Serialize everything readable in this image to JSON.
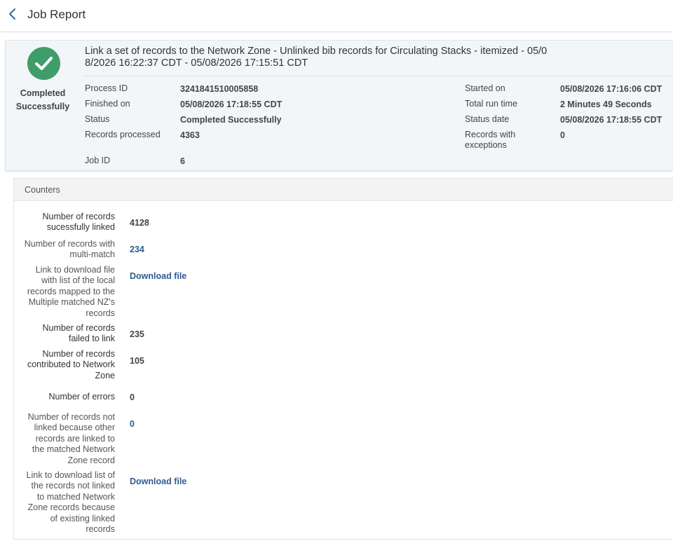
{
  "header": {
    "title": "Job Report",
    "back_icon": "chevron-left-icon",
    "accent": "#3a70a8"
  },
  "summary": {
    "status_icon": "check-circle-icon",
    "status_color": "#3f9d6c",
    "status_text_1": "Completed",
    "status_text_2": "Successfully",
    "title_line_1": "Link a set of records to the Network Zone - Unlinked bib records for Circulating Stacks - itemized - 05/0",
    "title_line_2": "8/2026 16:22:37 CDT - 05/08/2026 17:15:51 CDT",
    "left_fields": [
      {
        "label": "Process ID",
        "value": "3241841510005858"
      },
      {
        "label": "Finished on",
        "value": "05/08/2026 17:18:55 CDT"
      },
      {
        "label": "Status",
        "value": "Completed Successfully"
      },
      {
        "label": "Records processed",
        "value": "4363"
      },
      {
        "label": "Job ID",
        "value": "6"
      }
    ],
    "right_fields": [
      {
        "label": "Started on",
        "value": "05/08/2026 17:16:06 CDT"
      },
      {
        "label": "Total run time",
        "value": "2 Minutes 49 Seconds"
      },
      {
        "label": "Status date",
        "value": "05/08/2026 17:18:55 CDT"
      },
      {
        "label_1": "Records with",
        "label_2": "exceptions",
        "value": "0"
      }
    ]
  },
  "counters": {
    "heading": "Counters",
    "rows": [
      {
        "lines": [
          "Number of records",
          "sucessfully linked"
        ],
        "value": "4128",
        "link": false
      },
      {
        "lines": [
          "Number of records with",
          "multi-match"
        ],
        "value": "234",
        "link": true
      },
      {
        "lines": [
          "Link to download file",
          "with list of the local",
          "records mapped to the",
          "Multiple matched NZ's",
          "records"
        ],
        "value": "Download file",
        "link": true
      },
      {
        "lines": [
          "Number of records",
          "failed to link"
        ],
        "value": "235",
        "link": false
      },
      {
        "lines": [
          "Number of records",
          "contributed to Network",
          "Zone"
        ],
        "value": "105",
        "link": false
      },
      {
        "lines": [
          "Number of errors"
        ],
        "value": "0",
        "link": false
      },
      {
        "lines": [
          "Number of records not",
          "linked because other",
          "records are linked to",
          "the matched Network",
          "Zone record"
        ],
        "value": "0",
        "link": true
      },
      {
        "lines": [
          "Link to download list of",
          "the records not linked",
          "to matched Network",
          "Zone records because",
          "of existing linked",
          "records"
        ],
        "value": "Download file",
        "link": true
      }
    ]
  }
}
